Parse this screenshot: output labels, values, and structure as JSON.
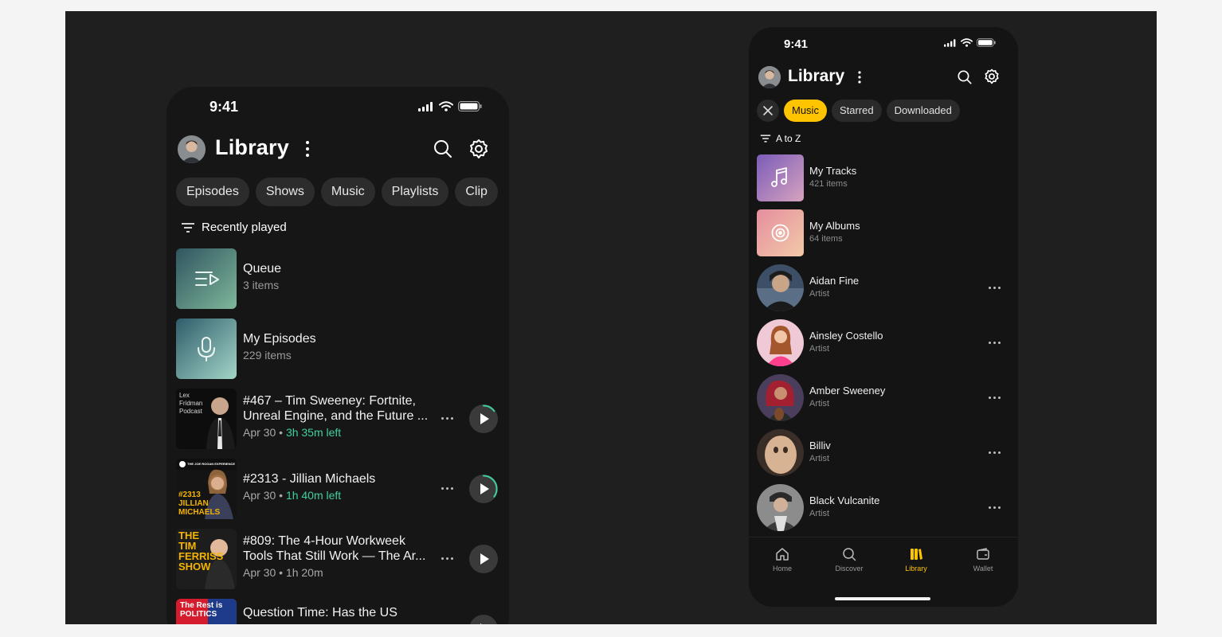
{
  "phone1": {
    "status_time": "9:41",
    "title": "Library",
    "chips": [
      "Episodes",
      "Shows",
      "Music",
      "Playlists",
      "Clip"
    ],
    "sort_label": "Recently played",
    "items": [
      {
        "name": "Queue",
        "sub": "3 items",
        "icon": "queue-icon"
      },
      {
        "name": "My Episodes",
        "sub": "229 items",
        "icon": "microphone-icon"
      },
      {
        "title_line1": "#467 – Tim Sweeney: Fortnite,",
        "title_line2": "Unreal Engine, and the Future ...",
        "date": "Apr 30 •",
        "left": "3h 35m left",
        "art_text": "Lex Fridman Podcast",
        "progress": 0.15
      },
      {
        "title_line1": "#2313 - Jillian Michaels",
        "date": "Apr 30 •",
        "left": "1h 40m left",
        "art_text": "#2313 JILLIAN MICHAELS",
        "art_header": "THE JOE ROGAN EXPERIENCE",
        "progress": 0.35
      },
      {
        "title_line1": "#809: The 4-Hour Workweek",
        "title_line2": "Tools That Still Work — The Ar...",
        "date": "Apr 30 • 1h 20m",
        "art_text": "THE TIM FERRISS SHOW"
      },
      {
        "title_line1": "Question Time: Has the US",
        "art_text": "The Rest is POLITICS"
      }
    ]
  },
  "phone2": {
    "status_time": "9:41",
    "title": "Library",
    "chips": [
      "Music",
      "Starred",
      "Downloaded"
    ],
    "active_chip": "Music",
    "sort_label": "A to Z",
    "items": [
      {
        "name": "My Tracks",
        "sub": "421 items",
        "icon": "music-note-icon"
      },
      {
        "name": "My Albums",
        "sub": "64 items",
        "icon": "album-icon"
      },
      {
        "name": "Aidan Fine",
        "sub": "Artist"
      },
      {
        "name": "Ainsley Costello",
        "sub": "Artist"
      },
      {
        "name": "Amber Sweeney",
        "sub": "Artist"
      },
      {
        "name": "Billiv",
        "sub": "Artist"
      },
      {
        "name": "Black Vulcanite",
        "sub": "Artist"
      }
    ],
    "tabs": [
      {
        "label": "Home",
        "icon": "home-icon"
      },
      {
        "label": "Discover",
        "icon": "search-icon"
      },
      {
        "label": "Library",
        "icon": "library-icon"
      },
      {
        "label": "Wallet",
        "icon": "wallet-icon"
      }
    ],
    "active_tab": "Library"
  },
  "colors": {
    "accent": "#ffc400",
    "progress": "#3ed0a0",
    "background": "#161616"
  }
}
